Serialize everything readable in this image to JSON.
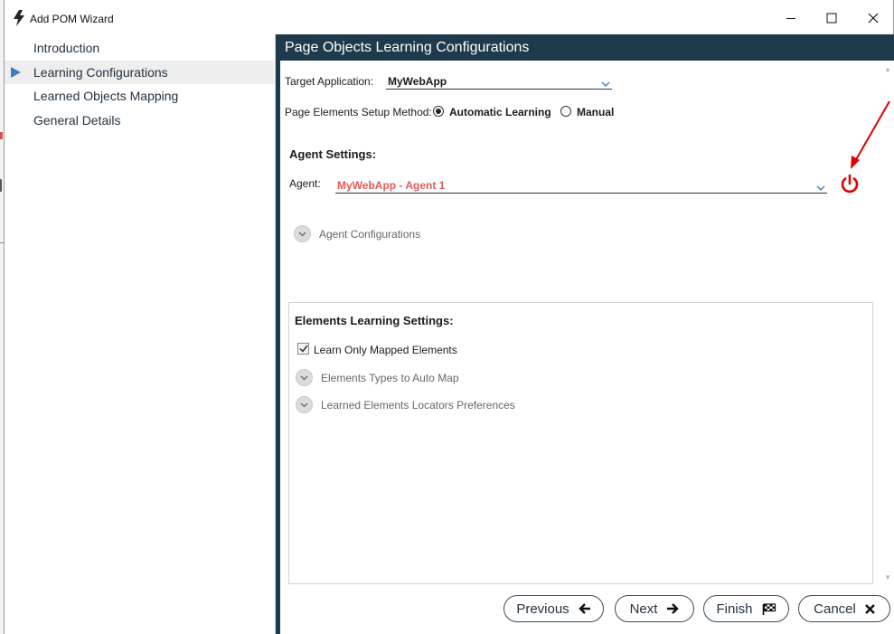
{
  "window": {
    "title": "Add POM Wizard",
    "icon": "bolt-icon",
    "controls": [
      "minimize-icon",
      "maximize-icon",
      "close-icon"
    ]
  },
  "sidebar": {
    "items": [
      {
        "label": "Introduction",
        "active": false
      },
      {
        "label": "Learning Configurations",
        "active": true
      },
      {
        "label": "Learned Objects Mapping",
        "active": false
      },
      {
        "label": "General Details",
        "active": false
      }
    ]
  },
  "panel": {
    "title": "Page Objects Learning Configurations",
    "target_app": {
      "label": "Target Application:",
      "value": "MyWebApp"
    },
    "setup_method": {
      "label": "Page Elements Setup Method:",
      "options": [
        {
          "label": "Automatic Learning",
          "selected": true
        },
        {
          "label": "Manual",
          "selected": false
        }
      ]
    },
    "agent_settings": {
      "heading": "Agent Settings:",
      "agent_label": "Agent:",
      "agent_value": "MyWebApp - Agent 1",
      "agent_value_color": "#e05a5a",
      "power_icon": "power-icon",
      "power_color": "#e00000",
      "expander": "Agent Configurations"
    },
    "elements_settings": {
      "heading": "Elements Learning Settings:",
      "checkbox": {
        "label": "Learn Only Mapped Elements",
        "checked": true
      },
      "expanders": [
        "Elements Types to Auto Map",
        "Learned Elements Locators Preferences"
      ]
    }
  },
  "footer": {
    "previous": {
      "label": "Previous",
      "icon": "arrow-left-icon"
    },
    "next": {
      "label": "Next",
      "icon": "arrow-right-icon"
    },
    "finish": {
      "label": "Finish",
      "icon": "flag-icon"
    },
    "cancel": {
      "label": "Cancel",
      "icon": "x-icon"
    }
  },
  "colors": {
    "header_bg": "#1e3a4c",
    "accent_blue": "#3a7fc2",
    "annotation_red": "#e00000"
  }
}
